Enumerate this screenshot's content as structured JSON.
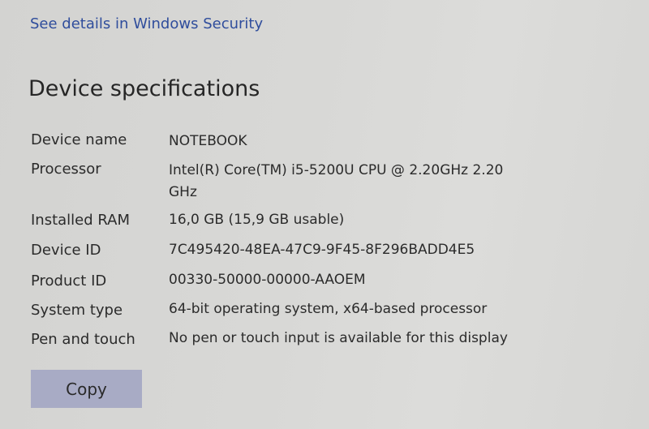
{
  "security_link": "See details in Windows Security",
  "section_title": "Device specifications",
  "specs": [
    {
      "label": "Device name",
      "value": "NOTEBOOK"
    },
    {
      "label": "Processor",
      "value": "Intel(R) Core(TM) i5-5200U CPU @ 2.20GHz   2.20 GHz"
    },
    {
      "label": "Installed RAM",
      "value": "16,0 GB (15,9 GB usable)"
    },
    {
      "label": "Device ID",
      "value": "7C495420-48EA-47C9-9F45-8F296BADD4E5"
    },
    {
      "label": "Product ID",
      "value": "00330-50000-00000-AAOEM"
    },
    {
      "label": "System type",
      "value": "64-bit operating system, x64-based processor"
    },
    {
      "label": "Pen and touch",
      "value": "No pen or touch input is available for this display"
    }
  ],
  "copy_button_label": "Copy"
}
